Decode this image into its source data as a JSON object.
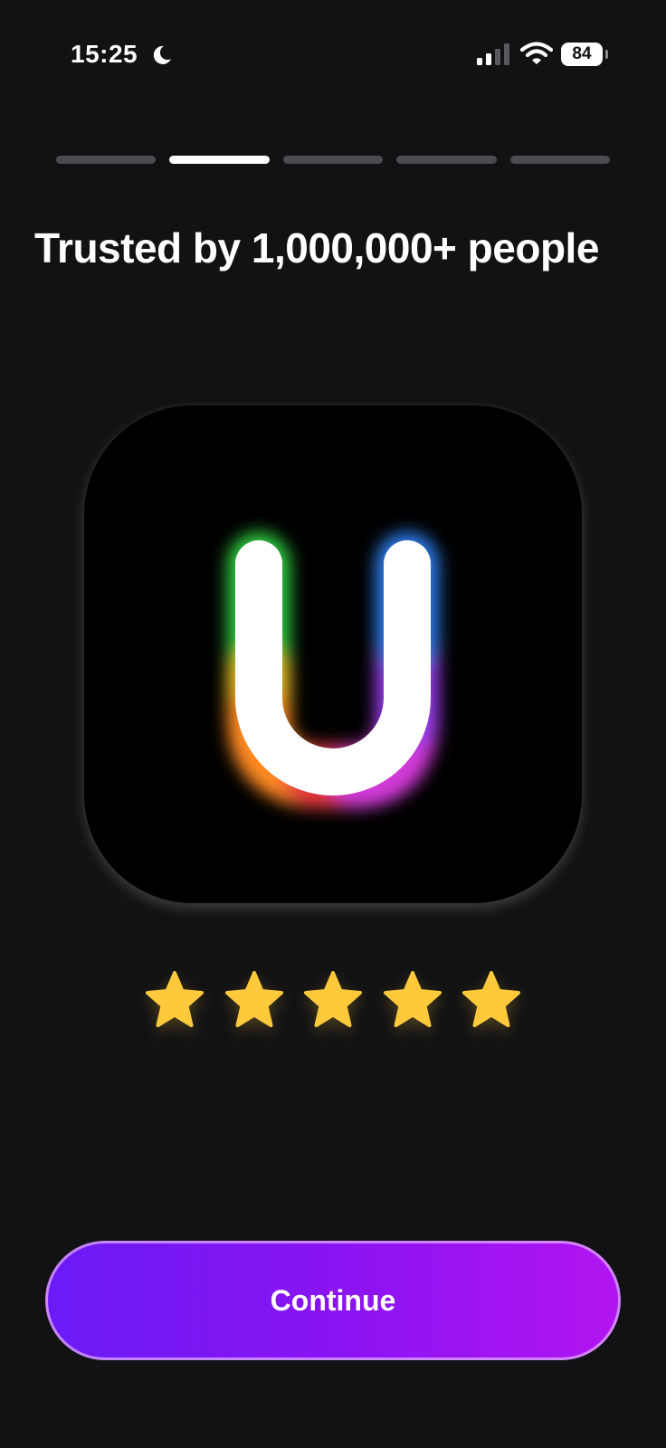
{
  "status_bar": {
    "time": "15:25",
    "battery": "84",
    "icons": [
      "moon-icon",
      "cellular-signal-icon",
      "wifi-icon",
      "battery-icon"
    ]
  },
  "onboarding": {
    "total_steps": 5,
    "current_step": 2,
    "headline": "Trusted by 1,000,000+ people",
    "rating_stars": 5,
    "logo_letter": "U"
  },
  "actions": {
    "continue_label": "Continue"
  },
  "colors": {
    "background": "#121214",
    "segment_inactive": "#4c4c50",
    "segment_active": "#ffffff",
    "star": "#ffc93c",
    "button_gradient_start": "#6a1bf5",
    "button_gradient_end": "#b114f0"
  }
}
